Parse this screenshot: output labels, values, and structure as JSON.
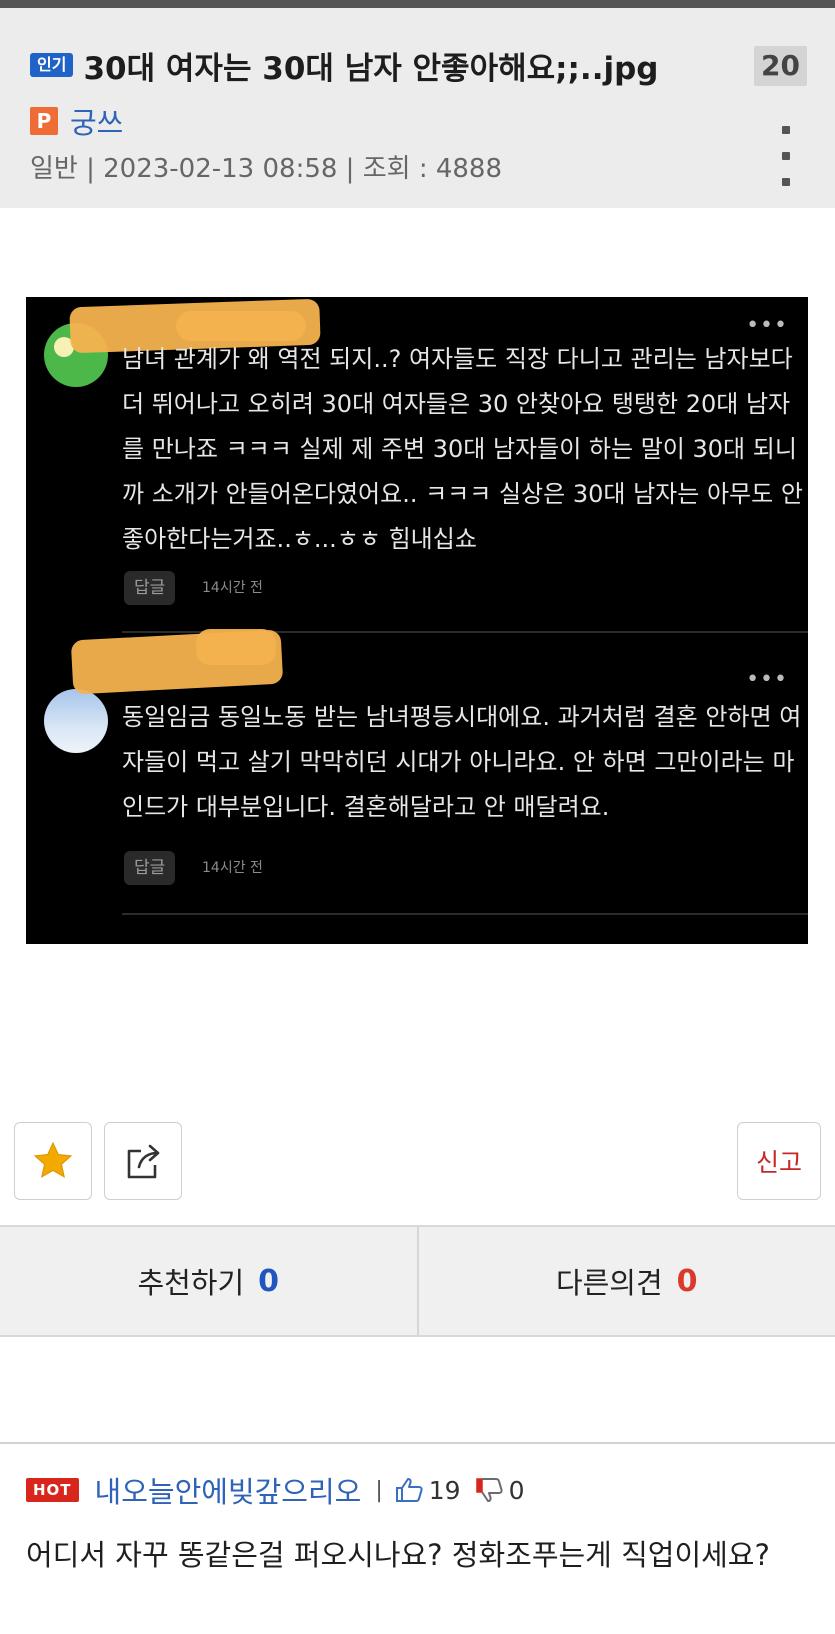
{
  "post": {
    "badge": "인기",
    "title": "30대 여자는 30대 남자 안좋아해요;;..jpg",
    "comment_count": "20",
    "author_badge": "P",
    "author": "궁쓰",
    "meta": "일반 | 2023-02-13 08:58 | 조회 : 4888"
  },
  "screenshot": {
    "comments": [
      {
        "text": "남녀 관계가 왜 역전 되지..? 여자들도 직장 다니고 관리는 남자보다 더 뛰어나고 오히려 30대 여자들은 30 안찾아요 탱탱한 20대 남자를 만나죠 ㅋㅋㅋ 실제 제 주변 30대 남자들이 하는 말이 30대 되니까 소개가 안들어온다였어요.. ㅋㅋㅋ 실상은 30대 남자는 아무도 안좋아한다는거죠..ㅎ...ㅎㅎ 힘내십쇼",
        "reply_label": "답글",
        "time": "14시간 전",
        "more": "•••"
      },
      {
        "text": "동일임금 동일노동 받는 남녀평등시대에요. 과거처럼 결혼 안하면 여자들이 먹고 살기 막막히던 시대가 아니라요. 안 하면 그만이라는 마인드가 대부분입니다. 결혼해달라고 안 매달려요.",
        "reply_label": "답글",
        "time": "14시간 전",
        "more": "•••"
      }
    ]
  },
  "actions": {
    "favorite_icon": "star-icon",
    "share_icon": "share-icon",
    "report_label": "신고"
  },
  "votes": {
    "recommend_label": "추천하기",
    "recommend_count": "0",
    "dissent_label": "다른의견",
    "dissent_count": "0"
  },
  "best_comment": {
    "badge": "HOT",
    "author": "내오늘안에빚갚으리오",
    "separator": "|",
    "likes": "19",
    "dislikes": "0",
    "text": "어디서 자꾸 똥같은걸 퍼오시나요? 정화조푸는게 직업이세요?"
  },
  "colors": {
    "accent_blue": "#1f56c0",
    "accent_red": "#d93a2b",
    "star": "#f2a900"
  }
}
